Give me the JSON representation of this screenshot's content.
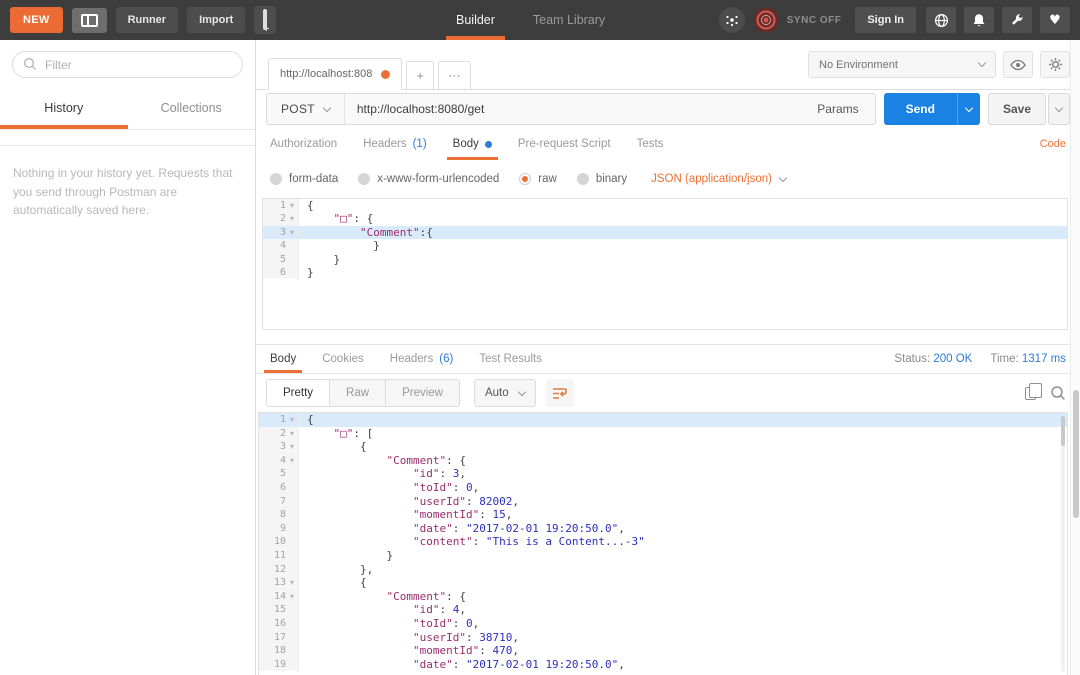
{
  "topbar": {
    "new_button": "NEW",
    "runner_button": "Runner",
    "import_button": "Import",
    "tabs": [
      {
        "label": "Builder"
      },
      {
        "label": "Team Library"
      }
    ],
    "sync_label": "SYNC OFF",
    "signin_button": "Sign In",
    "accent_orange": "#ec6b35"
  },
  "sidebar": {
    "filter_placeholder": "Filter",
    "tabs": [
      {
        "label": "History"
      },
      {
        "label": "Collections"
      }
    ],
    "empty_message": "Nothing in your history yet. Requests that you send through Postman are automatically saved here."
  },
  "main": {
    "request_tab_title": "http://localhost:808",
    "plus_tab": "+",
    "more_tab": "⋯",
    "environment": {
      "selected": "No Environment"
    },
    "request": {
      "method": "POST",
      "url": "http://localhost:8080/get",
      "params_button": "Params",
      "send_button": "Send",
      "save_button": "Save",
      "tabs": [
        {
          "label": "Authorization",
          "count": ""
        },
        {
          "label": "Headers",
          "count": "(1)"
        },
        {
          "label": "Body",
          "count": ""
        },
        {
          "label": "Pre-request Script",
          "count": ""
        },
        {
          "label": "Tests",
          "count": ""
        }
      ],
      "code_link": "Code",
      "body_modes": [
        {
          "label": "form-data"
        },
        {
          "label": "x-www-form-urlencoded"
        },
        {
          "label": "raw"
        },
        {
          "label": "binary"
        }
      ],
      "content_type": "JSON (application/json)",
      "editor_lines": [
        {
          "n": 1,
          "fold": true,
          "hl": false,
          "t": [
            [
              "p",
              "{"
            ]
          ]
        },
        {
          "n": 2,
          "fold": true,
          "hl": false,
          "t": [
            [
              "p",
              "    "
            ],
            [
              "k",
              "\"□\""
            ],
            [
              "p",
              ": {"
            ]
          ]
        },
        {
          "n": 3,
          "fold": true,
          "hl": true,
          "t": [
            [
              "p",
              "        "
            ],
            [
              "k",
              "\"Comment\""
            ],
            [
              "p",
              ":{"
            ]
          ]
        },
        {
          "n": 4,
          "fold": false,
          "hl": false,
          "t": [
            [
              "p",
              "          }"
            ]
          ]
        },
        {
          "n": 5,
          "fold": false,
          "hl": false,
          "t": [
            [
              "p",
              "    }"
            ]
          ]
        },
        {
          "n": 6,
          "fold": false,
          "hl": false,
          "t": [
            [
              "p",
              "}"
            ]
          ]
        }
      ]
    },
    "response": {
      "tabs": [
        {
          "label": "Body",
          "count": ""
        },
        {
          "label": "Cookies",
          "count": ""
        },
        {
          "label": "Headers",
          "count": "(6)"
        },
        {
          "label": "Test Results",
          "count": ""
        }
      ],
      "status_label": "Status:",
      "status_value": "200 OK",
      "time_label": "Time:",
      "time_value": "1317 ms",
      "view_modes": [
        {
          "label": "Pretty"
        },
        {
          "label": "Raw"
        },
        {
          "label": "Preview"
        }
      ],
      "format_select": "Auto",
      "editor_lines": [
        {
          "n": 1,
          "fold": true,
          "hl": true,
          "t": [
            [
              "p",
              "{"
            ]
          ]
        },
        {
          "n": 2,
          "fold": true,
          "hl": false,
          "t": [
            [
              "p",
              "    "
            ],
            [
              "k",
              "\"□\""
            ],
            [
              "p",
              ": ["
            ]
          ]
        },
        {
          "n": 3,
          "fold": true,
          "hl": false,
          "t": [
            [
              "p",
              "        {"
            ]
          ]
        },
        {
          "n": 4,
          "fold": true,
          "hl": false,
          "t": [
            [
              "p",
              "            "
            ],
            [
              "k",
              "\"Comment\""
            ],
            [
              "p",
              ": {"
            ]
          ]
        },
        {
          "n": 5,
          "fold": false,
          "hl": false,
          "t": [
            [
              "p",
              "                "
            ],
            [
              "k",
              "\"id\""
            ],
            [
              "p",
              ": "
            ],
            [
              "v",
              "3"
            ],
            [
              "p",
              ","
            ]
          ]
        },
        {
          "n": 6,
          "fold": false,
          "hl": false,
          "t": [
            [
              "p",
              "                "
            ],
            [
              "k",
              "\"toId\""
            ],
            [
              "p",
              ": "
            ],
            [
              "v",
              "0"
            ],
            [
              "p",
              ","
            ]
          ]
        },
        {
          "n": 7,
          "fold": false,
          "hl": false,
          "t": [
            [
              "p",
              "                "
            ],
            [
              "k",
              "\"userId\""
            ],
            [
              "p",
              ": "
            ],
            [
              "v",
              "82002"
            ],
            [
              "p",
              ","
            ]
          ]
        },
        {
          "n": 8,
          "fold": false,
          "hl": false,
          "t": [
            [
              "p",
              "                "
            ],
            [
              "k",
              "\"momentId\""
            ],
            [
              "p",
              ": "
            ],
            [
              "v",
              "15"
            ],
            [
              "p",
              ","
            ]
          ]
        },
        {
          "n": 9,
          "fold": false,
          "hl": false,
          "t": [
            [
              "p",
              "                "
            ],
            [
              "k",
              "\"date\""
            ],
            [
              "p",
              ": "
            ],
            [
              "v",
              "\"2017-02-01 19:20:50.0\""
            ],
            [
              "p",
              ","
            ]
          ]
        },
        {
          "n": 10,
          "fold": false,
          "hl": false,
          "t": [
            [
              "p",
              "                "
            ],
            [
              "k",
              "\"content\""
            ],
            [
              "p",
              ": "
            ],
            [
              "v",
              "\"This is a Content...-3\""
            ]
          ]
        },
        {
          "n": 11,
          "fold": false,
          "hl": false,
          "t": [
            [
              "p",
              "            }"
            ]
          ]
        },
        {
          "n": 12,
          "fold": false,
          "hl": false,
          "t": [
            [
              "p",
              "        },"
            ]
          ]
        },
        {
          "n": 13,
          "fold": true,
          "hl": false,
          "t": [
            [
              "p",
              "        {"
            ]
          ]
        },
        {
          "n": 14,
          "fold": true,
          "hl": false,
          "t": [
            [
              "p",
              "            "
            ],
            [
              "k",
              "\"Comment\""
            ],
            [
              "p",
              ": {"
            ]
          ]
        },
        {
          "n": 15,
          "fold": false,
          "hl": false,
          "t": [
            [
              "p",
              "                "
            ],
            [
              "k",
              "\"id\""
            ],
            [
              "p",
              ": "
            ],
            [
              "v",
              "4"
            ],
            [
              "p",
              ","
            ]
          ]
        },
        {
          "n": 16,
          "fold": false,
          "hl": false,
          "t": [
            [
              "p",
              "                "
            ],
            [
              "k",
              "\"toId\""
            ],
            [
              "p",
              ": "
            ],
            [
              "v",
              "0"
            ],
            [
              "p",
              ","
            ]
          ]
        },
        {
          "n": 17,
          "fold": false,
          "hl": false,
          "t": [
            [
              "p",
              "                "
            ],
            [
              "k",
              "\"userId\""
            ],
            [
              "p",
              ": "
            ],
            [
              "v",
              "38710"
            ],
            [
              "p",
              ","
            ]
          ]
        },
        {
          "n": 18,
          "fold": false,
          "hl": false,
          "t": [
            [
              "p",
              "                "
            ],
            [
              "k",
              "\"momentId\""
            ],
            [
              "p",
              ": "
            ],
            [
              "v",
              "470"
            ],
            [
              "p",
              ","
            ]
          ]
        },
        {
          "n": 19,
          "fold": false,
          "hl": false,
          "t": [
            [
              "p",
              "                "
            ],
            [
              "k",
              "\"date\""
            ],
            [
              "p",
              ": "
            ],
            [
              "v",
              "\"2017-02-01 19:20:50.0\""
            ],
            [
              "p",
              ","
            ]
          ]
        }
      ]
    }
  }
}
